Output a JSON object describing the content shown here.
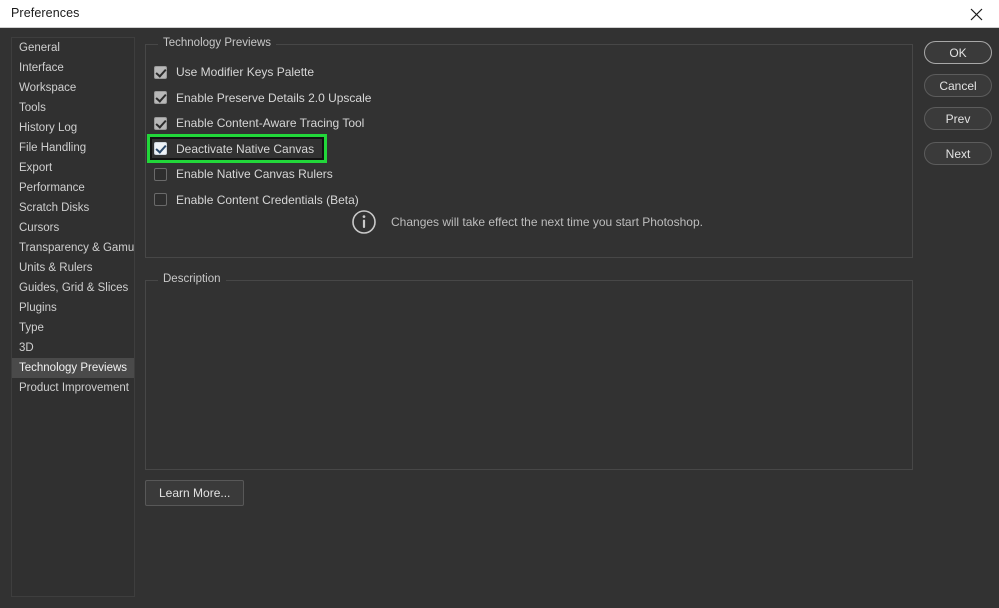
{
  "window": {
    "title": "Preferences",
    "close_icon": "close-icon",
    "background_color": "#323232",
    "titlebar_color": "#ffffff"
  },
  "sidebar": {
    "selected": "Technology Previews",
    "items": [
      {
        "label": "General",
        "selected": false
      },
      {
        "label": "Interface",
        "selected": false
      },
      {
        "label": "Workspace",
        "selected": false
      },
      {
        "label": "Tools",
        "selected": false
      },
      {
        "label": "History Log",
        "selected": false
      },
      {
        "label": "File Handling",
        "selected": false
      },
      {
        "label": "Export",
        "selected": false
      },
      {
        "label": "Performance",
        "selected": false
      },
      {
        "label": "Scratch Disks",
        "selected": false
      },
      {
        "label": "Cursors",
        "selected": false
      },
      {
        "label": "Transparency & Gamut",
        "selected": false
      },
      {
        "label": "Units & Rulers",
        "selected": false
      },
      {
        "label": "Guides, Grid & Slices",
        "selected": false
      },
      {
        "label": "Plugins",
        "selected": false
      },
      {
        "label": "Type",
        "selected": false
      },
      {
        "label": "3D",
        "selected": false
      },
      {
        "label": "Technology Previews",
        "selected": true
      },
      {
        "label": "Product Improvement",
        "selected": false
      }
    ]
  },
  "tech_previews": {
    "legend": "Technology Previews",
    "options": [
      {
        "label": "Use Modifier Keys Palette",
        "checked": true,
        "highlighted": false
      },
      {
        "label": "Enable Preserve Details 2.0 Upscale",
        "checked": true,
        "highlighted": false
      },
      {
        "label": "Enable Content-Aware Tracing Tool",
        "checked": true,
        "highlighted": false
      },
      {
        "label": "Deactivate Native Canvas",
        "checked": true,
        "highlighted": true
      },
      {
        "label": "Enable Native Canvas Rulers",
        "checked": false,
        "highlighted": false
      },
      {
        "label": "Enable Content Credentials (Beta)",
        "checked": false,
        "highlighted": false
      }
    ],
    "note": {
      "icon": "info-circle-icon",
      "text": "Changes will take effect the next time you start Photoshop."
    },
    "highlight_color": "#22d73a"
  },
  "description": {
    "legend": "Description",
    "body": ""
  },
  "buttons": {
    "ok": "OK",
    "cancel": "Cancel",
    "prev": "Prev",
    "next": "Next",
    "learn_more": "Learn More..."
  }
}
